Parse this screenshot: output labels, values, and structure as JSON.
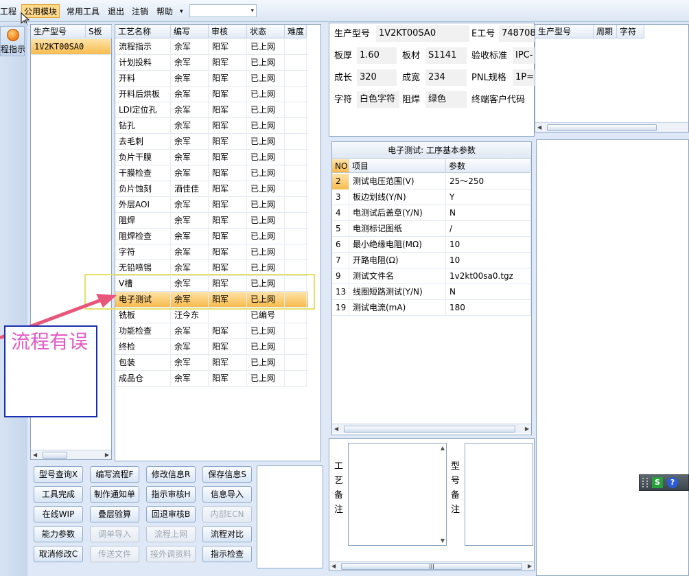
{
  "menubar": {
    "items": [
      "工程",
      "公用模块",
      "常用工具",
      "退出",
      "注销",
      "帮助"
    ],
    "dropdown_arrow": "▾",
    "combo_value": ""
  },
  "leftnav": {
    "label": "程指示"
  },
  "model_list": {
    "headers": [
      "生产型号",
      "S板"
    ],
    "rows": [
      [
        "1V2KT00SA0",
        ""
      ]
    ]
  },
  "process_table": {
    "headers": [
      "工艺名称",
      "编写",
      "审核",
      "状态",
      "难度"
    ],
    "rows": [
      [
        "流程指示",
        "余军",
        "阳军",
        "已上网",
        ""
      ],
      [
        "计划投料",
        "余军",
        "阳军",
        "已上网",
        ""
      ],
      [
        "开料",
        "余军",
        "阳军",
        "已上网",
        ""
      ],
      [
        "开料后烘板",
        "余军",
        "阳军",
        "已上网",
        ""
      ],
      [
        "LDI定位孔",
        "余军",
        "阳军",
        "已上网",
        ""
      ],
      [
        "钻孔",
        "余军",
        "阳军",
        "已上网",
        ""
      ],
      [
        "去毛刺",
        "余军",
        "阳军",
        "已上网",
        ""
      ],
      [
        "负片干膜",
        "余军",
        "阳军",
        "已上网",
        ""
      ],
      [
        "干膜检查",
        "余军",
        "阳军",
        "已上网",
        ""
      ],
      [
        "负片蚀刻",
        "酒佳佳",
        "阳军",
        "已上网",
        ""
      ],
      [
        "外层AOI",
        "余军",
        "阳军",
        "已上网",
        ""
      ],
      [
        "阻焊",
        "余军",
        "阳军",
        "已上网",
        ""
      ],
      [
        "阻焊检查",
        "余军",
        "阳军",
        "已上网",
        ""
      ],
      [
        "字符",
        "余军",
        "阳军",
        "已上网",
        ""
      ],
      [
        "无铅喷锡",
        "余军",
        "阳军",
        "已上网",
        ""
      ],
      [
        "V槽",
        "余军",
        "阳军",
        "已上网",
        ""
      ],
      [
        "电子测试",
        "余军",
        "阳军",
        "已上网",
        ""
      ],
      [
        "铣板",
        "汪今东",
        "",
        "已编号",
        ""
      ],
      [
        "功能检查",
        "余军",
        "阳军",
        "已上网",
        ""
      ],
      [
        "终检",
        "余军",
        "阳军",
        "已上网",
        ""
      ],
      [
        "包装",
        "余军",
        "阳军",
        "已上网",
        ""
      ],
      [
        "成品仓",
        "余军",
        "阳军",
        "已上网",
        ""
      ]
    ],
    "selected_index": 16
  },
  "buttons": [
    [
      "型号查询X",
      "编写流程F",
      "修改信息R",
      "保存信息S"
    ],
    [
      "工具完成",
      "制作通知单",
      "指示审核H",
      "信息导入"
    ],
    [
      "在线WIP",
      "叠层验算",
      "回退审核B",
      "内部ECN"
    ],
    [
      "能力参数",
      "调单导入",
      "流程上网",
      "流程对比"
    ],
    [
      "取消修改C",
      "传送文件",
      "接外调资料",
      "指示检查"
    ]
  ],
  "disabled_buttons": [
    "内部ECN",
    "调单导入",
    "流程上网",
    "传送文件",
    "接外调资料"
  ],
  "info": {
    "model_label": "生产型号",
    "model_value": "1V2KT00SA0",
    "e_label": "E工号",
    "e_value": "748708",
    "thick_label": "板厚",
    "thick_value": "1.60",
    "material_label": "板材",
    "material_value": "S1141",
    "std_label": "验收标准",
    "std_value": "IPC-",
    "len_label": "成长",
    "len_value": "320",
    "wid_label": "成宽",
    "wid_value": "234",
    "pnl_label": "PNL规格",
    "pnl_value": "1P=",
    "char_label": "字符",
    "char_value": "白色字符",
    "mask_label": "阻焊",
    "mask_value": "绿色",
    "cust_label": "终端客户代码"
  },
  "right_grid": {
    "headers": [
      "生产型号",
      "周期",
      "字符"
    ]
  },
  "param_table": {
    "title": "电子测试: 工序基本参数",
    "headers": [
      "NO",
      "项目",
      "参数"
    ],
    "rows": [
      [
        "2",
        "测试电压范围(V)",
        "25～250"
      ],
      [
        "3",
        "板边划线(Y/N)",
        "Y"
      ],
      [
        "4",
        "电测试后盖章(Y/N)",
        "N"
      ],
      [
        "5",
        "电测标记图纸",
        "/"
      ],
      [
        "6",
        "最小绝缘电阻(MΩ)",
        "10"
      ],
      [
        "7",
        "开路电阻(Ω)",
        "10"
      ],
      [
        "9",
        "测试文件名",
        "1v2kt00sa0.tgz"
      ],
      [
        "13",
        "线圈短路测试(Y/N)",
        "N"
      ],
      [
        "19",
        "测试电流(mA)",
        "180"
      ]
    ]
  },
  "notes": {
    "process_label": "工艺备注",
    "model_label": "型号备注"
  },
  "annotation": {
    "text": "流程有误",
    "color": "#e45ac8"
  },
  "scroll_glyphs": {
    "left": "◀",
    "right": "▶",
    "up": "▲",
    "down": "▼",
    "grip": "|||"
  },
  "mini_toolbar": {
    "s_icon": "S",
    "help_icon": "?"
  }
}
